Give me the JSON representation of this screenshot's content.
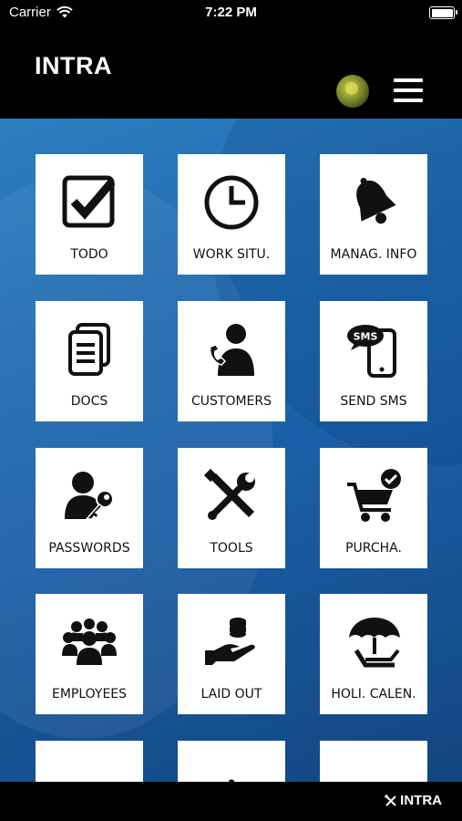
{
  "status_bar": {
    "carrier": "Carrier",
    "time": "7:22 PM"
  },
  "header": {
    "title": "INTRA",
    "menu_icon": "hamburger-icon",
    "avatar": "user-avatar"
  },
  "tiles": [
    {
      "label": "TODO",
      "icon": "checkbox-icon"
    },
    {
      "label": "WORK SITU.",
      "icon": "clock-icon"
    },
    {
      "label": "MANAG. INFO",
      "icon": "bell-icon"
    },
    {
      "label": "DOCS",
      "icon": "documents-icon"
    },
    {
      "label": "CUSTOMERS",
      "icon": "customer-phone-icon"
    },
    {
      "label": "SEND SMS",
      "icon": "sms-phone-icon"
    },
    {
      "label": "PASSWORDS",
      "icon": "user-key-icon"
    },
    {
      "label": "TOOLS",
      "icon": "tools-icon"
    },
    {
      "label": "PURCHA.",
      "icon": "cart-check-icon"
    },
    {
      "label": "EMPLOYEES",
      "icon": "employees-group-icon"
    },
    {
      "label": "LAID OUT",
      "icon": "hand-coins-icon"
    },
    {
      "label": "HOLI. CALEN.",
      "icon": "beach-umbrella-icon"
    }
  ],
  "bottom_bar": {
    "brand": "INTRA"
  }
}
